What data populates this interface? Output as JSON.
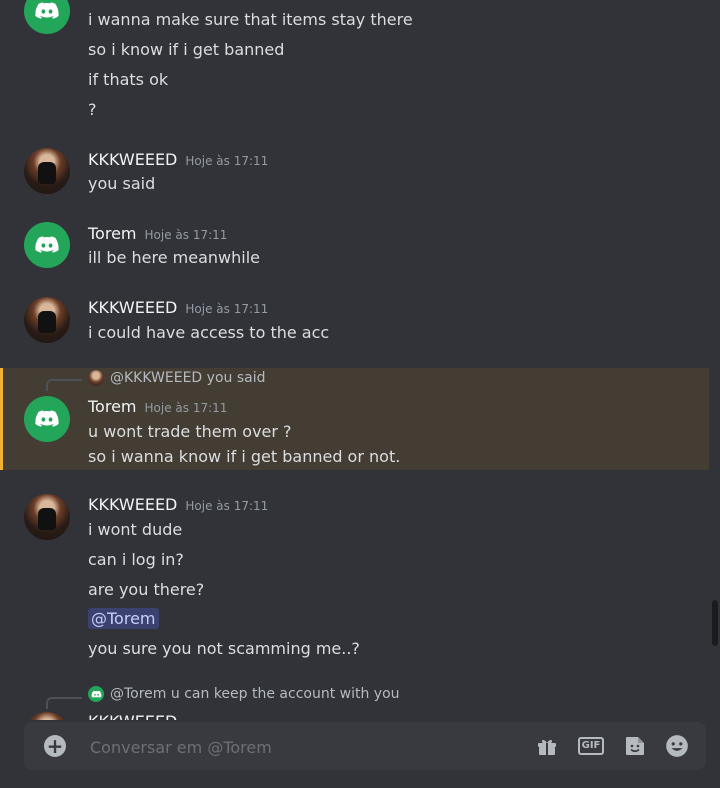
{
  "messages": [
    {
      "author": "",
      "lines": [
        "i wanna make sure that items stay there",
        "so i know if i get banned",
        "if thats ok",
        "?"
      ]
    },
    {
      "author": "KKKWEEED",
      "timestamp": "Hoje às 17:11",
      "lines": [
        "you said"
      ]
    },
    {
      "author": "Torem",
      "timestamp": "Hoje às 17:11",
      "lines": [
        "ill be here meanwhile"
      ]
    },
    {
      "author": "KKKWEEED",
      "timestamp": "Hoje às 17:11",
      "lines": [
        "i could have access to the acc"
      ]
    },
    {
      "reply_to": "@KKKWEEED",
      "reply_text": "you said",
      "author": "Torem",
      "timestamp": "Hoje às 17:11",
      "lines": [
        "u wont trade them over ?",
        "so i wanna know if i get banned or not."
      ]
    },
    {
      "author": "KKKWEEED",
      "timestamp": "Hoje às 17:11",
      "lines": [
        "i wont dude",
        "can i log in?",
        "are you there?",
        "@Torem",
        "you sure you not scamming me..?"
      ]
    },
    {
      "reply_to": "@Torem",
      "reply_text": "u can keep the account with you",
      "author": "KKKWEEED"
    }
  ],
  "composer": {
    "placeholder": "Conversar em @Torem"
  },
  "icons": {
    "discord_avatar": "discord-logo-icon",
    "plus": "plus-circle-icon",
    "gift": "gift-icon",
    "gif": "GIF",
    "sticker": "sticker-icon",
    "emoji": "emoji-icon"
  },
  "colors": {
    "background": "#313338",
    "highlight": "#433d34",
    "highlight_bar": "#f0b232",
    "discord_green": "#23a55a",
    "mention_bg": "#3c4270"
  }
}
